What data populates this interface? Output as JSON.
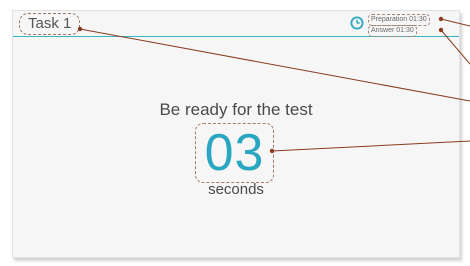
{
  "task": {
    "title": "Task 1"
  },
  "timers": {
    "preparation": "Preparation 01:30",
    "answer": "Answer 01:30"
  },
  "countdown": {
    "prompt": "Be ready for the test",
    "value": "03",
    "unit": "seconds"
  },
  "colors": {
    "accent": "#2aa7c0",
    "divider": "#36b5c7",
    "connector": "#8b3a1e",
    "annotation_border": "#a97a5f"
  },
  "icons": {
    "timer": "clock-icon"
  }
}
